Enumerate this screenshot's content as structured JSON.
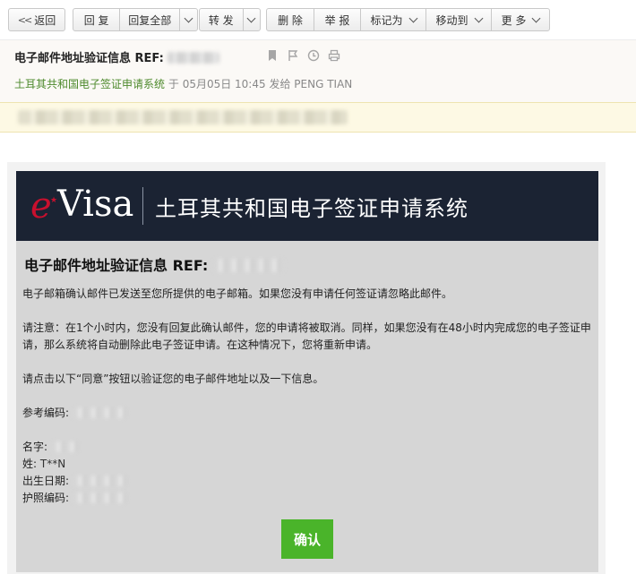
{
  "toolbar": {
    "back": "返回",
    "reply": "回 复",
    "reply_all": "回复全部",
    "forward": "转 发",
    "delete": "删 除",
    "report": "举 报",
    "mark_as": "标记为",
    "move_to": "移动到",
    "more": "更 多"
  },
  "header": {
    "subject": "电子邮件地址验证信息 REF:",
    "sender": "土耳其共和国电子签证申请系统",
    "at": "于",
    "datetime": "05月05日 10:45",
    "sent_to_label": "发给",
    "recipient": "PENG TIAN"
  },
  "email": {
    "logo_e": "e",
    "logo_visa": "Visa",
    "banner_title": "土耳其共和国电子签证申请系统",
    "title": "电子邮件地址验证信息 REF:",
    "p1": "电子邮箱确认邮件已发送至您所提供的电子邮箱。如果您没有申请任何签证请忽略此邮件。",
    "p2": "请注意：在1个小时内，您没有回复此确认邮件，您的申请将被取消。同样，如果您没有在48小时内完成您的电子签证申请，那么系统将自动删除此电子签证申请。在这种情况下，您将重新申请。",
    "p3": "请点击以下“同意”按钮以验证您的电子邮件地址以及一下信息。",
    "ref_label": "参考编码:",
    "given_name_label": "名字:",
    "surname_label": "姓:",
    "surname_value": "T**N",
    "dob_label": "出生日期:",
    "passport_label": "护照编码:",
    "confirm": "确认"
  }
}
